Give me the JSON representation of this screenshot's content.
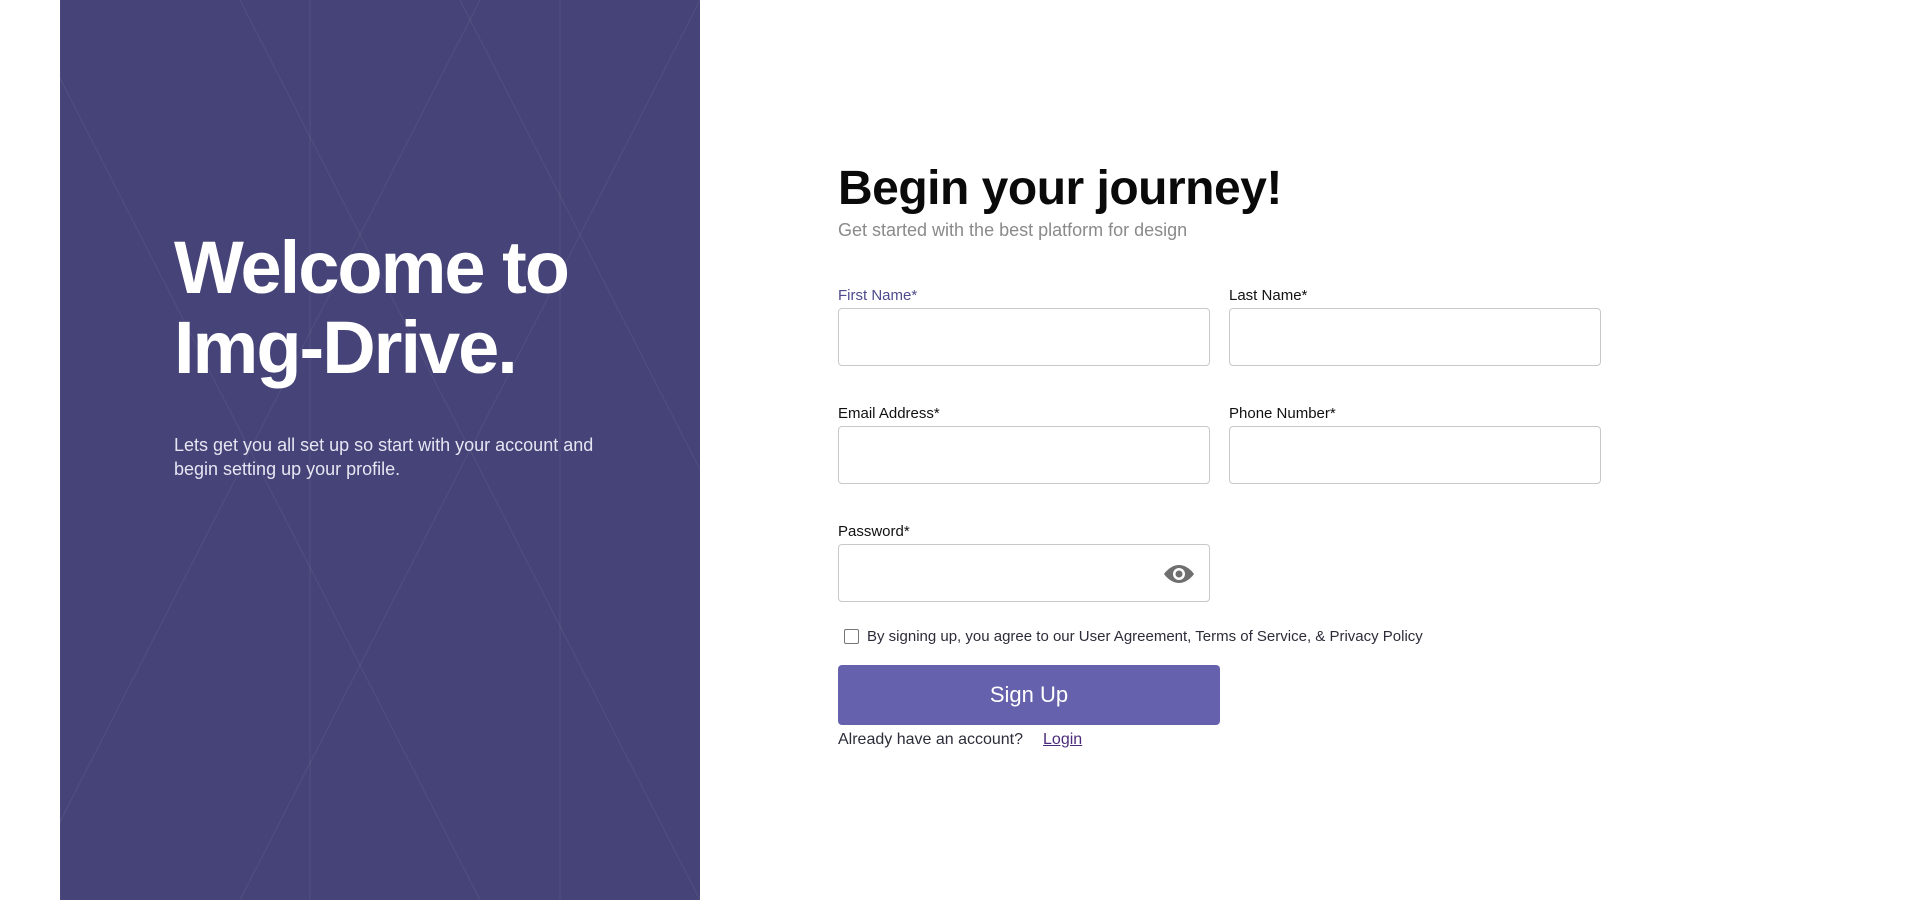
{
  "hero": {
    "title_line1": "Welcome to",
    "title_line2": "Img-Drive.",
    "subtitle_line1": "Lets get you all set up so start with your account and",
    "subtitle_line2": "begin setting up your profile.",
    "background_color": "#454377"
  },
  "form": {
    "title": "Begin your journey!",
    "subtitle": "Get started with the best platform for design",
    "fields": {
      "first_name": {
        "label": "First Name*",
        "value": ""
      },
      "last_name": {
        "label": "Last Name*",
        "value": ""
      },
      "email": {
        "label": "Email Address*",
        "value": ""
      },
      "phone": {
        "label": "Phone Number*",
        "value": ""
      },
      "password": {
        "label": "Password*",
        "value": "",
        "toggle_icon": "eye-icon"
      }
    },
    "agreement": {
      "text": "By signing up, you agree to our User Agreement, Terms of Service, & Privacy Policy",
      "checked": false
    },
    "submit_label": "Sign Up",
    "login_prompt": "Already have an account?",
    "login_link": "Login",
    "accent_color": "#6561ad"
  }
}
